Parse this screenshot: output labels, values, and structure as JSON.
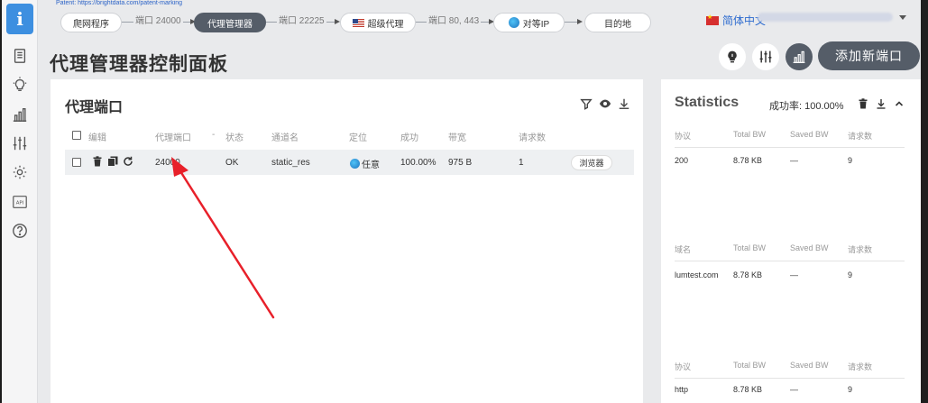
{
  "patent": "Patent: https://brightdata.com/patent-marking",
  "flow": {
    "step1": "爬网程序",
    "link1": "端口 24000",
    "step2": "代理管理器",
    "link2": "端口 22225",
    "step3": "超级代理",
    "link3": "端口 80, 443",
    "step4": "对等IP",
    "step5": "目的地"
  },
  "lang": {
    "label": "简体中文"
  },
  "page": {
    "title": "代理管理器控制面板",
    "add_button": "添加新端口"
  },
  "ports": {
    "title": "代理端口",
    "columns": [
      "编辑",
      "代理端口",
      "状态",
      "通道名",
      "定位",
      "成功",
      "带宽",
      "请求数"
    ],
    "sort_marker": "-",
    "row": {
      "port": "24000",
      "status": "OK",
      "zone": "static_res",
      "location": "任意",
      "success": "100.00%",
      "bandwidth": "975 B",
      "requests": "1",
      "browser_button": "浏览器"
    }
  },
  "stats": {
    "title": "Statistics",
    "success_label": "成功率: 100.00%",
    "sections": [
      {
        "columns": [
          "协议",
          "Total BW",
          "Saved BW",
          "请求数"
        ],
        "row": [
          "200",
          "8.78 KB",
          "—",
          "9"
        ]
      },
      {
        "columns": [
          "域名",
          "Total BW",
          "Saved BW",
          "请求数"
        ],
        "row": [
          "lumtest.com",
          "8.78 KB",
          "—",
          "9"
        ]
      },
      {
        "columns": [
          "协议",
          "Total BW",
          "Saved BW",
          "请求数"
        ],
        "row": [
          "http",
          "8.78 KB",
          "—",
          "9"
        ]
      }
    ]
  },
  "icons": {
    "logo": "info-icon",
    "sidebar": [
      "document-icon",
      "lightbulb-icon",
      "bar-chart-icon",
      "sliders-icon",
      "gear-icon",
      "api-icon",
      "help-icon"
    ]
  },
  "colors": {
    "accent_dark": "#555d68",
    "logo_blue": "#3d8fe0",
    "link_blue": "#2d6bcf",
    "annotation_red": "#e8202a"
  }
}
